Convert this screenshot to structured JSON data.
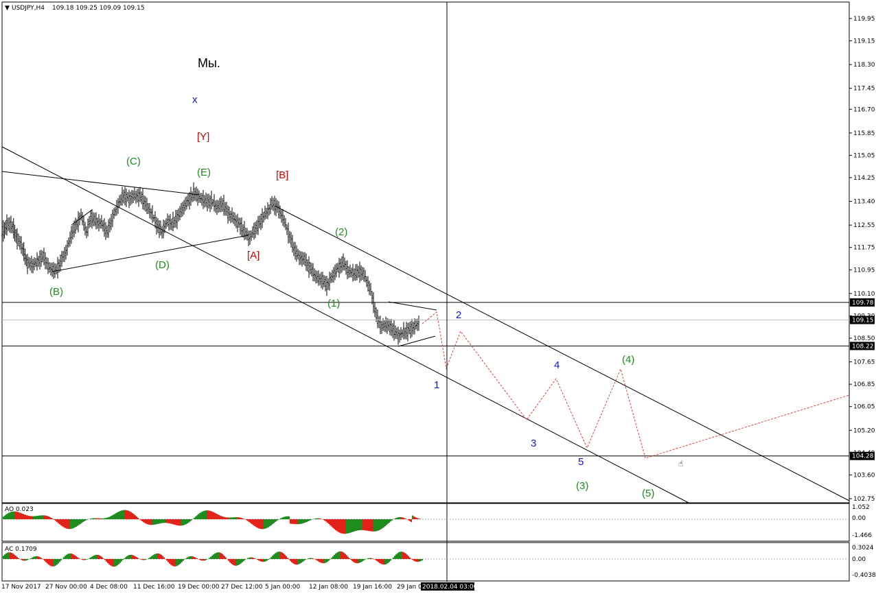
{
  "header": {
    "symbol": "USDJPY,H4",
    "ohlc": "109.18 109.25 109.09 109.15"
  },
  "colors": {
    "green": "#1e8c1e",
    "red": "#e2231a",
    "blue": "#1414c8",
    "dark_red": "#d40000",
    "projection": "#e8413a",
    "line": "#000000"
  },
  "chart_data": {
    "type": "candlestick",
    "price_axis": {
      "ticks": [
        "119.95",
        "119.15",
        "118.30",
        "117.45",
        "116.70",
        "115.85",
        "115.05",
        "114.25",
        "113.40",
        "112.55",
        "111.75",
        "110.95",
        "110.10",
        "109.30",
        "108.50",
        "107.65",
        "106.85",
        "106.05",
        "105.20",
        "104.40",
        "103.60",
        "102.75"
      ],
      "highlighted": [
        "109.78",
        "109.15",
        "108.22",
        "104.28"
      ]
    },
    "time_axis": {
      "labels": [
        "17 Nov 2017",
        "27 Nov 00:00",
        "4 Dec 08:00",
        "11 Dec 16:00",
        "19 Dec 00:00",
        "27 Dec 12:00",
        "5 Jan 00:00",
        "12 Jan 08:00",
        "19 Jan 16:00",
        "29 Jan 0"
      ],
      "crosshair_label": "2018.02.04 03:00"
    },
    "horizontal_levels": [
      109.78,
      108.22,
      104.28
    ],
    "wave_labels": [
      {
        "text": "Мы.",
        "color": "black"
      },
      {
        "text": "x",
        "color": "blue"
      },
      {
        "text": "[Y]",
        "color": "dark_red"
      },
      {
        "text": "(C)",
        "color": "green"
      },
      {
        "text": "(E)",
        "color": "green"
      },
      {
        "text": "[B]",
        "color": "dark_red"
      },
      {
        "text": "(2)",
        "color": "green"
      },
      {
        "text": "[A]",
        "color": "dark_red"
      },
      {
        "text": "(D)",
        "color": "green"
      },
      {
        "text": "(B)",
        "color": "green"
      },
      {
        "text": "(1)",
        "color": "green"
      },
      {
        "text": "2",
        "color": "blue"
      },
      {
        "text": "1",
        "color": "blue"
      },
      {
        "text": "4",
        "color": "blue"
      },
      {
        "text": "(4)",
        "color": "green"
      },
      {
        "text": "3",
        "color": "blue"
      },
      {
        "text": "5",
        "color": "blue"
      },
      {
        "text": "(3)",
        "color": "green"
      },
      {
        "text": "(5)",
        "color": "green"
      }
    ],
    "ao_panel": {
      "title": "AO 0.023",
      "ticks": [
        "1.052",
        "0.00",
        "-1.466"
      ]
    },
    "ac_panel": {
      "title": "AC 0.1709",
      "ticks": [
        "0.3024",
        "0.00",
        "-0.4038"
      ]
    }
  }
}
